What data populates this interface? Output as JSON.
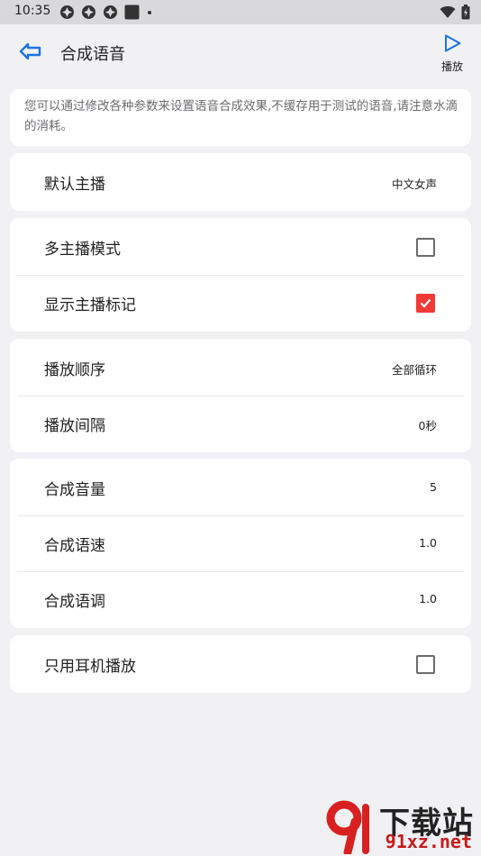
{
  "status": {
    "time": "10:35"
  },
  "header": {
    "title": "合成语音",
    "play_label": "播放"
  },
  "description": "您可以通过修改各种参数来设置语音合成效果,不缓存用于测试的语音,请注意水滴的消耗。",
  "settings": {
    "default_anchor": {
      "label": "默认主播",
      "value": "中文女声"
    },
    "multi_anchor": {
      "label": "多主播模式",
      "checked": false
    },
    "show_anchor_mark": {
      "label": "显示主播标记",
      "checked": true
    },
    "play_order": {
      "label": "播放顺序",
      "value": "全部循环"
    },
    "play_interval": {
      "label": "播放间隔",
      "value": "0秒"
    },
    "volume": {
      "label": "合成音量",
      "value": "5"
    },
    "speed": {
      "label": "合成语速",
      "value": "1.0"
    },
    "pitch": {
      "label": "合成语调",
      "value": "1.0"
    },
    "headphone_only": {
      "label": "只用耳机播放",
      "checked": false
    }
  },
  "watermark": {
    "title": "下载站",
    "url": "91xz.net"
  },
  "colors": {
    "accent": "#1a73e8",
    "checked": "#f03a37",
    "background": "#f1f1f4"
  }
}
